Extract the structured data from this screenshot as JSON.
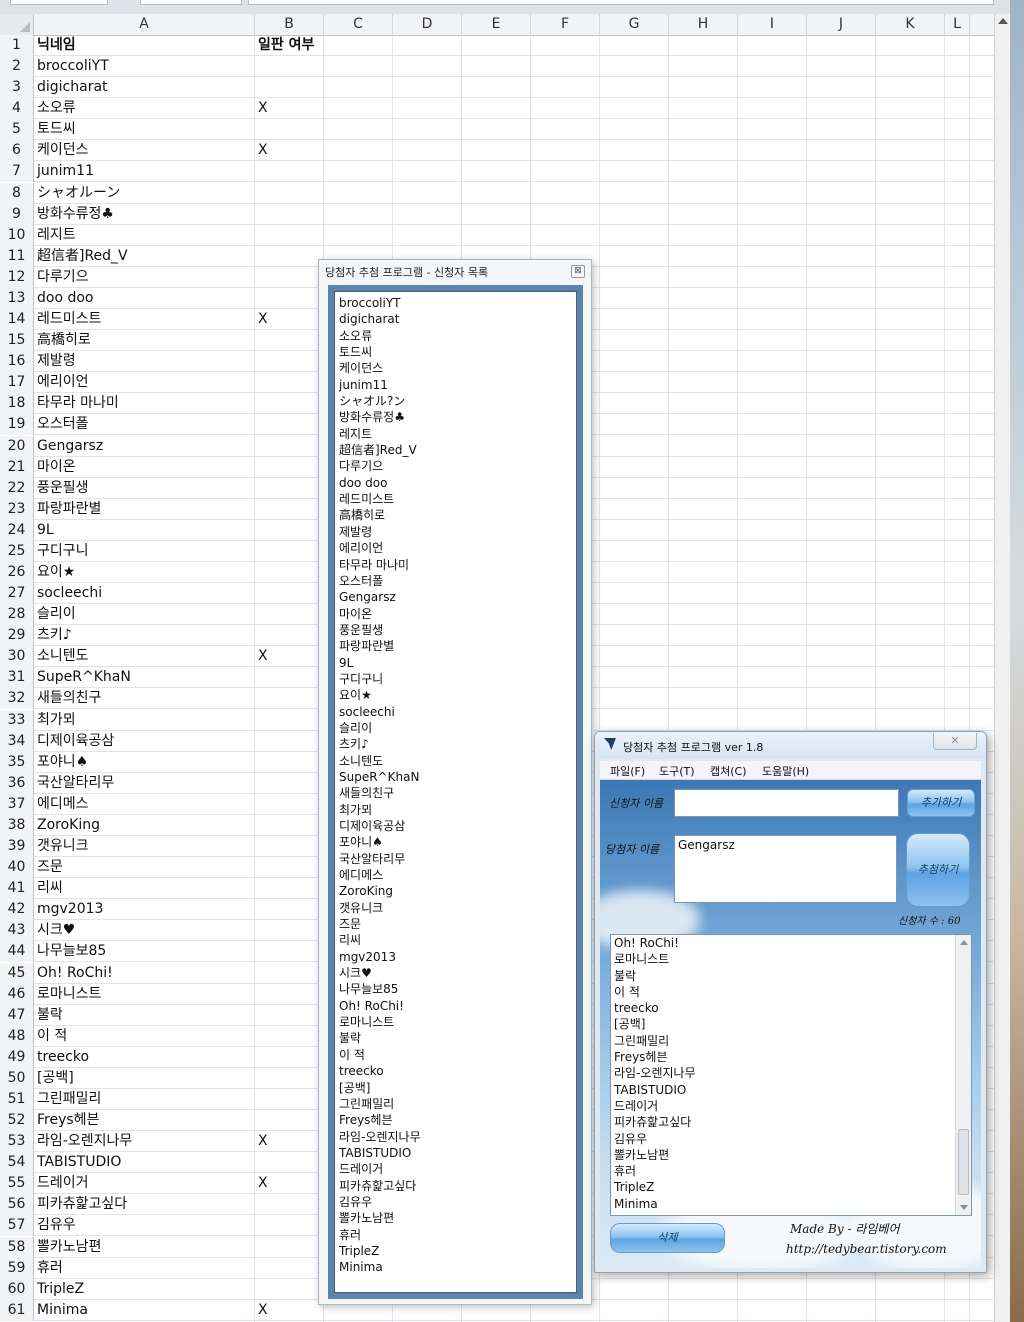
{
  "sheet": {
    "columns": [
      "A",
      "B",
      "C",
      "D",
      "E",
      "F",
      "G",
      "H",
      "I",
      "J",
      "K",
      "L"
    ],
    "rows": [
      {
        "num": "1",
        "a": "닉네임",
        "b": "일판 여부"
      },
      {
        "num": "2",
        "a": "broccoliYT",
        "b": ""
      },
      {
        "num": "3",
        "a": "digicharat",
        "b": ""
      },
      {
        "num": "4",
        "a": "소오류",
        "b": "X"
      },
      {
        "num": "5",
        "a": "토드씨",
        "b": ""
      },
      {
        "num": "6",
        "a": "케이던스",
        "b": "X"
      },
      {
        "num": "7",
        "a": "junim11",
        "b": ""
      },
      {
        "num": "8",
        "a": "シャオルーン",
        "b": ""
      },
      {
        "num": "9",
        "a": "방화수류정♣",
        "b": ""
      },
      {
        "num": "10",
        "a": "레지트",
        "b": ""
      },
      {
        "num": "11",
        "a": "超信者]Red_V",
        "b": ""
      },
      {
        "num": "12",
        "a": "다루기으",
        "b": ""
      },
      {
        "num": "13",
        "a": "doo doo",
        "b": ""
      },
      {
        "num": "14",
        "a": "레드미스트",
        "b": "X"
      },
      {
        "num": "15",
        "a": "高橋히로",
        "b": ""
      },
      {
        "num": "16",
        "a": "제발령",
        "b": ""
      },
      {
        "num": "17",
        "a": "에리이언",
        "b": ""
      },
      {
        "num": "18",
        "a": "타무라 마나미",
        "b": ""
      },
      {
        "num": "19",
        "a": "오스터폴",
        "b": ""
      },
      {
        "num": "20",
        "a": "Gengarsz",
        "b": ""
      },
      {
        "num": "21",
        "a": "마이온",
        "b": ""
      },
      {
        "num": "22",
        "a": "풍운필생",
        "b": ""
      },
      {
        "num": "23",
        "a": "파랑파란별",
        "b": ""
      },
      {
        "num": "24",
        "a": "9L",
        "b": ""
      },
      {
        "num": "25",
        "a": "구디구니",
        "b": ""
      },
      {
        "num": "26",
        "a": "요이★",
        "b": ""
      },
      {
        "num": "27",
        "a": "socleechi",
        "b": ""
      },
      {
        "num": "28",
        "a": "슬리이",
        "b": ""
      },
      {
        "num": "29",
        "a": "츠키♪",
        "b": ""
      },
      {
        "num": "30",
        "a": "소니텐도",
        "b": "X"
      },
      {
        "num": "31",
        "a": "SupeR^KhaN",
        "b": ""
      },
      {
        "num": "32",
        "a": "새들의친구",
        "b": ""
      },
      {
        "num": "33",
        "a": "최가뫼",
        "b": ""
      },
      {
        "num": "34",
        "a": "디제이육공삼",
        "b": ""
      },
      {
        "num": "35",
        "a": "포야니♠",
        "b": ""
      },
      {
        "num": "36",
        "a": "국산알타리무",
        "b": ""
      },
      {
        "num": "37",
        "a": "에디메스",
        "b": ""
      },
      {
        "num": "38",
        "a": "ZoroKing",
        "b": ""
      },
      {
        "num": "39",
        "a": "갯유니크",
        "b": ""
      },
      {
        "num": "40",
        "a": "즈문",
        "b": ""
      },
      {
        "num": "41",
        "a": "리씨",
        "b": ""
      },
      {
        "num": "42",
        "a": "mgv2013",
        "b": ""
      },
      {
        "num": "43",
        "a": "시크♥",
        "b": ""
      },
      {
        "num": "44",
        "a": "나무늘보85",
        "b": ""
      },
      {
        "num": "45",
        "a": "Oh! RoChi!",
        "b": ""
      },
      {
        "num": "46",
        "a": "로마니스트",
        "b": ""
      },
      {
        "num": "47",
        "a": "불락",
        "b": ""
      },
      {
        "num": "48",
        "a": "이 적",
        "b": ""
      },
      {
        "num": "49",
        "a": "treecko",
        "b": ""
      },
      {
        "num": "50",
        "a": "[공백]",
        "b": ""
      },
      {
        "num": "51",
        "a": "그린패밀리",
        "b": ""
      },
      {
        "num": "52",
        "a": "Freys헤븐",
        "b": ""
      },
      {
        "num": "53",
        "a": "라임-오렌지나무",
        "b": "X"
      },
      {
        "num": "54",
        "a": "TABISTUDIO",
        "b": ""
      },
      {
        "num": "55",
        "a": "드레이거",
        "b": "X"
      },
      {
        "num": "56",
        "a": "피카츄핥고싶다",
        "b": ""
      },
      {
        "num": "57",
        "a": "김유우",
        "b": ""
      },
      {
        "num": "58",
        "a": "뽈카노남편",
        "b": ""
      },
      {
        "num": "59",
        "a": "휴러",
        "b": ""
      },
      {
        "num": "60",
        "a": "TripleZ",
        "b": ""
      },
      {
        "num": "61",
        "a": "Minima",
        "b": "X"
      }
    ]
  },
  "list_window": {
    "title": "당첨자 추첨 프로그램 - 신청자 목록",
    "close_label": "⊠",
    "items": [
      "broccoliYT",
      "digicharat",
      "소오류",
      "토드씨",
      "케이던스",
      "junim11",
      "シャオル?ン",
      "방화수류정♣",
      "레지트",
      "超信者]Red_V",
      "다루기으",
      "doo doo",
      "레드미스트",
      "高橋히로",
      "제발령",
      "에리이언",
      "타무라 마나미",
      "오스터폴",
      "Gengarsz",
      "마이온",
      "풍운필생",
      "파랑파란별",
      "9L",
      "구디구니",
      "요이★",
      "socleechi",
      "슬리이",
      "츠키♪",
      "소니텐도",
      "SupeR^KhaN",
      "새들의친구",
      "최가뫼",
      "디제이육공삼",
      "포야니♠",
      "국산알타리무",
      "에디메스",
      "ZoroKing",
      "갯유니크",
      "즈문",
      "리씨",
      "mgv2013",
      "시크♥",
      "나무늘보85",
      "Oh! RoChi!",
      "로마니스트",
      "불락",
      "이 적",
      "treecko",
      "[공백]",
      "그린패밀리",
      "Freys헤븐",
      "라임-오렌지나무",
      "TABISTUDIO",
      "드레이거",
      "피카츄핥고싶다",
      "김유우",
      "뽈카노남편",
      "휴러",
      "TripleZ",
      "Minima"
    ]
  },
  "app": {
    "title": "당첨자 추첨 프로그램 ver 1.8",
    "close_label": "✕",
    "menu": [
      "파일(F)",
      "도구(T)",
      "캡쳐(C)",
      "도움말(H)"
    ],
    "applicant_label": "신청자 이름",
    "applicant_value": "",
    "add_button": "추가하기",
    "winner_label": "당첨자 이름",
    "winner_value": "Gengarsz",
    "draw_button": "추첨하기",
    "count_text": "신청자 수 : 60",
    "entries": [
      "Oh! RoChi!",
      "로마니스트",
      "불락",
      "이 적",
      "treecko",
      "[공백]",
      "그린패밀리",
      "Freys헤븐",
      "라임-오렌지나무",
      "TABISTUDIO",
      "드레이거",
      "피카츄핥고싶다",
      "김유우",
      "뽈카노남편",
      "휴러",
      "TripleZ",
      "Minima"
    ],
    "delete_button": "삭제",
    "credit": "Made By - 라임베어",
    "url": "http://tedybear.tistory.com"
  }
}
